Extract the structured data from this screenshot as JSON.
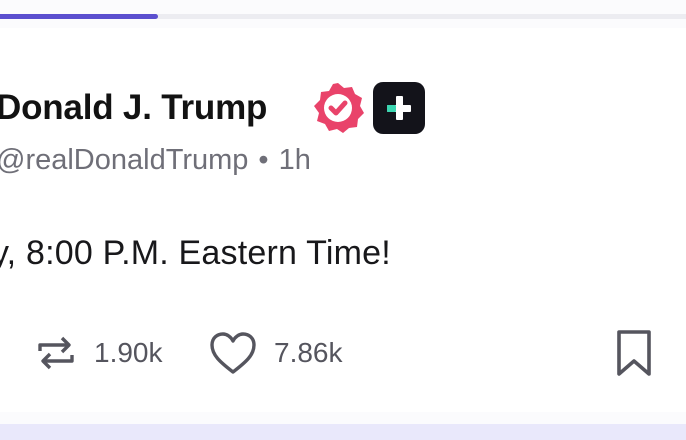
{
  "progress": {
    "fraction": 0.23,
    "color": "#5b4fcf"
  },
  "post": {
    "author_name": "Donald J. Trump",
    "handle": "@realDonaldTrump",
    "separator": "•",
    "time": "1h",
    "text": "y, 8:00 P.M. Eastern Time!",
    "verified_color": "#e9436a",
    "actions": {
      "repost_count": "1.90k",
      "like_count": "7.86k"
    }
  }
}
